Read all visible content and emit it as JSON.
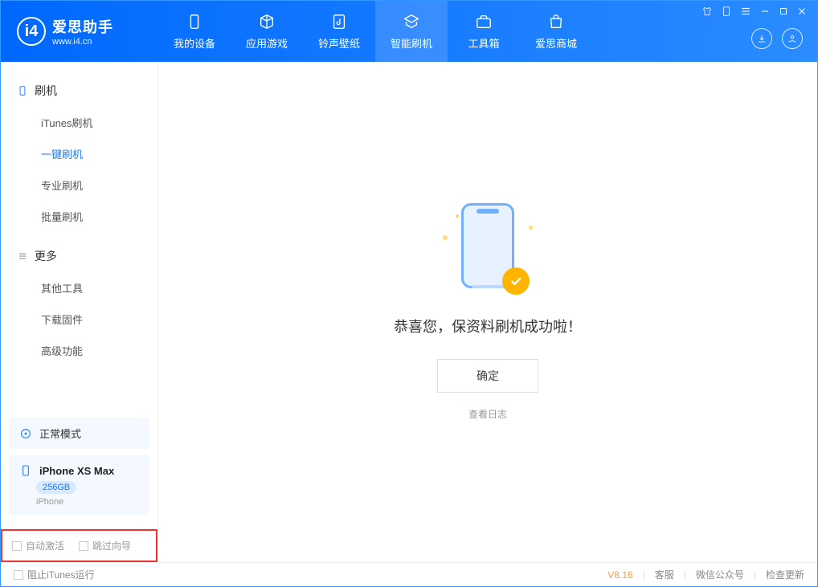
{
  "brand": {
    "cn": "爱思助手",
    "en": "www.i4.cn",
    "logo_letter": "i4"
  },
  "nav": [
    {
      "label": "我的设备",
      "icon": "device"
    },
    {
      "label": "应用游戏",
      "icon": "cube"
    },
    {
      "label": "铃声壁纸",
      "icon": "music"
    },
    {
      "label": "智能刷机",
      "icon": "refresh",
      "active": true
    },
    {
      "label": "工具箱",
      "icon": "toolbox"
    },
    {
      "label": "爱思商城",
      "icon": "bag"
    }
  ],
  "sidebar": {
    "s1_title": "刷机",
    "s1_items": [
      "iTunes刷机",
      "一键刷机",
      "专业刷机",
      "批量刷机"
    ],
    "s1_active_index": 1,
    "s2_title": "更多",
    "s2_items": [
      "其他工具",
      "下载固件",
      "高级功能"
    ]
  },
  "mode_card": {
    "label": "正常模式"
  },
  "device_card": {
    "name": "iPhone XS Max",
    "storage": "256GB",
    "sub": "iPhone"
  },
  "options": {
    "auto_activate": "自动激活",
    "skip_guide": "跳过向导"
  },
  "main": {
    "message": "恭喜您，保资料刷机成功啦！",
    "ok": "确定",
    "view_log": "查看日志"
  },
  "footer": {
    "block_itunes": "阻止iTunes运行",
    "version": "V8.16",
    "links": [
      "客服",
      "微信公众号",
      "检查更新"
    ]
  }
}
